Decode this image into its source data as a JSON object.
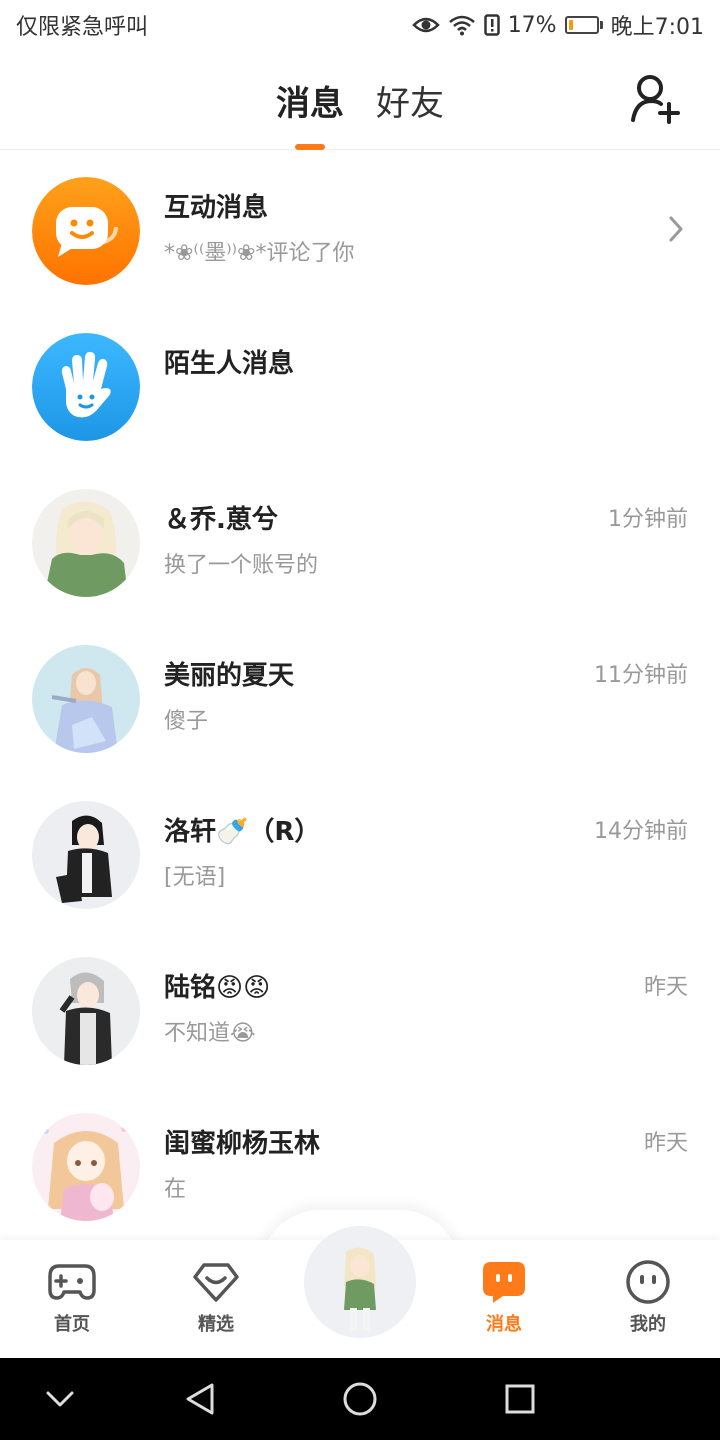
{
  "status_bar": {
    "carrier": "仅限紧急呼叫",
    "battery": "17%",
    "time": "晚上7:01",
    "battery_level": 0.17
  },
  "header": {
    "tabs": [
      {
        "label": "消息",
        "active": true
      },
      {
        "label": "好友",
        "active": false
      }
    ],
    "add_icon": "add-friend-icon"
  },
  "messages": [
    {
      "name": "互动消息",
      "preview": "*❀⁽⁽墨⁾⁾❀*评论了你",
      "time": "",
      "avatar": "chat-bubble-icon",
      "color": "#ff8a00"
    },
    {
      "name": "陌生人消息",
      "preview": "",
      "time": "",
      "avatar": "wave-hand-icon",
      "color": "#26a6ef"
    },
    {
      "name": "＆乔.葸兮",
      "preview": "换了一个账号的",
      "time": "1分钟前"
    },
    {
      "name": "美丽的夏天",
      "preview": "傻子",
      "time": "11分钟前"
    },
    {
      "name": "洛轩🍼（R）",
      "preview": "[无语]",
      "time": "14分钟前"
    },
    {
      "name": "陆铭😡😡",
      "preview": "不知道😭",
      "time": "昨天"
    },
    {
      "name": "闺蜜柳杨玉林",
      "preview": "在",
      "time": "昨天"
    }
  ],
  "bottom_nav": [
    {
      "label": "首页",
      "icon": "gamepad-icon"
    },
    {
      "label": "精选",
      "icon": "heart-badge-icon"
    },
    {
      "label": "消息",
      "icon": "message-icon",
      "active": true
    },
    {
      "label": "我的",
      "icon": "profile-face-icon"
    }
  ],
  "colors": {
    "accent": "#ff7a18",
    "blue": "#26a6ef"
  }
}
